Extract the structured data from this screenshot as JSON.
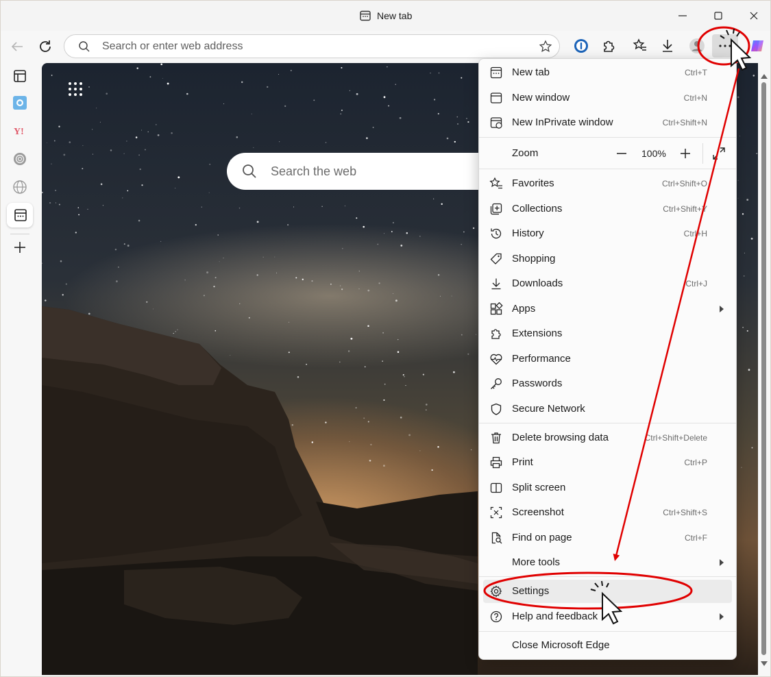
{
  "window": {
    "tab_title": "New tab",
    "controls": [
      "minimize-icon",
      "maximize-icon",
      "close-icon"
    ]
  },
  "toolbar": {
    "address_placeholder": "Search or enter web address",
    "icons": [
      "back-icon",
      "refresh-icon",
      "search-icon",
      "favorite-star-icon",
      "password-manager-icon",
      "extensions-icon",
      "favorites-icon",
      "downloads-icon",
      "profile-icon",
      "more-icon",
      "copilot-icon"
    ]
  },
  "sidebar": {
    "icons": [
      "tab-actions-icon",
      "outlook-icon",
      "yahoo-icon",
      "chatgpt-icon",
      "globe-icon",
      "newtab-icon",
      "add-icon"
    ]
  },
  "page": {
    "search_placeholder": "Search the web"
  },
  "menu": {
    "items": [
      {
        "label": "New tab",
        "shortcut": "Ctrl+T",
        "icon": "new-tab-icon"
      },
      {
        "label": "New window",
        "shortcut": "Ctrl+N",
        "icon": "new-window-icon"
      },
      {
        "label": "New InPrivate window",
        "shortcut": "Ctrl+Shift+N",
        "icon": "inprivate-icon"
      },
      {
        "label": "Favorites",
        "shortcut": "Ctrl+Shift+O",
        "icon": "favorites-icon"
      },
      {
        "label": "Collections",
        "shortcut": "Ctrl+Shift+Y",
        "icon": "collections-icon"
      },
      {
        "label": "History",
        "shortcut": "Ctrl+H",
        "icon": "history-icon"
      },
      {
        "label": "Shopping",
        "shortcut": "",
        "icon": "shopping-tag-icon"
      },
      {
        "label": "Downloads",
        "shortcut": "Ctrl+J",
        "icon": "downloads-icon"
      },
      {
        "label": "Apps",
        "shortcut": "",
        "icon": "apps-icon"
      },
      {
        "label": "Extensions",
        "shortcut": "",
        "icon": "extensions-icon"
      },
      {
        "label": "Performance",
        "shortcut": "",
        "icon": "performance-icon"
      },
      {
        "label": "Passwords",
        "shortcut": "",
        "icon": "key-icon"
      },
      {
        "label": "Secure Network",
        "shortcut": "",
        "icon": "shield-icon"
      },
      {
        "label": "Delete browsing data",
        "shortcut": "Ctrl+Shift+Delete",
        "icon": "trash-icon"
      },
      {
        "label": "Print",
        "shortcut": "Ctrl+P",
        "icon": "print-icon"
      },
      {
        "label": "Split screen",
        "shortcut": "",
        "icon": "split-screen-icon"
      },
      {
        "label": "Screenshot",
        "shortcut": "Ctrl+Shift+S",
        "icon": "screenshot-icon"
      },
      {
        "label": "Find on page",
        "shortcut": "Ctrl+F",
        "icon": "find-icon"
      },
      {
        "label": "More tools",
        "shortcut": "",
        "icon": ""
      },
      {
        "label": "Settings",
        "shortcut": "",
        "icon": "gear-icon"
      },
      {
        "label": "Help and feedback",
        "shortcut": "",
        "icon": "help-icon"
      },
      {
        "label": "Close Microsoft Edge",
        "shortcut": "",
        "icon": ""
      }
    ],
    "zoom": {
      "label": "Zoom",
      "value": "100%"
    }
  },
  "annotation": {
    "color": "#e00000"
  }
}
